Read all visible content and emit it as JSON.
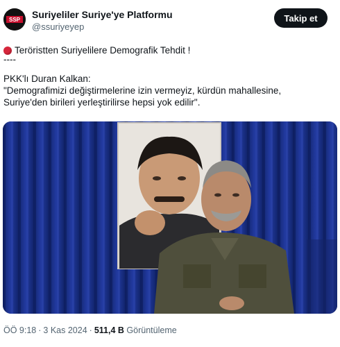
{
  "account": {
    "display_name": "Suriyeliler Suriye'ye Platformu",
    "handle": "@ssuriyeyep",
    "avatar_text": "SSP"
  },
  "follow_button": {
    "label": "Takip et"
  },
  "tweet": {
    "headline": "Teröristten Suriyelilere Demografik Tehdit !",
    "separator": "----",
    "speaker": "PKK'lı Duran Kalkan:",
    "quote_line1": "\"Demografimizi değiştirmelerine izin vermeyiz, kürdün mahallesine,",
    "quote_line2": "Suriye'den birileri yerleştirilirse hepsi yok edilir\"."
  },
  "meta": {
    "time": "ÖÖ 9:18",
    "separator": "·",
    "date": "3 Kas 2024",
    "views_count": "511,4 B",
    "views_label": "Görüntüleme"
  },
  "colors": {
    "text": "#0f1419",
    "secondary": "#536471",
    "button": "#0f1419",
    "emoji_red": "#d6263b",
    "curtain_blue": "#1a2f86"
  },
  "icons": {
    "headline_emoji": "red-circle-icon"
  }
}
